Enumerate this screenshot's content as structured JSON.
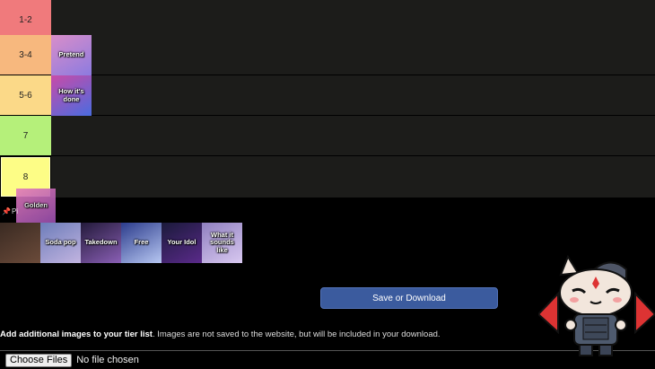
{
  "tiers": [
    {
      "label": "1-2",
      "color": "#f07a7c"
    },
    {
      "label": "3-4",
      "color": "#f7b87e"
    },
    {
      "label": "5-6",
      "color": "#fbd988"
    },
    {
      "label": "7",
      "color": "#b5f07a"
    },
    {
      "label": "8",
      "color": "#fdfd86"
    }
  ],
  "tier_items": {
    "t34": {
      "label": "Pretend",
      "colors": [
        "#d98ec9",
        "#8c7be0"
      ]
    },
    "t56": {
      "label": "How it's done",
      "colors": [
        "#c84ba8",
        "#4a6ce0"
      ]
    }
  },
  "dragging_item": {
    "label": "Golden",
    "colors": [
      "#e27ab9",
      "#9a4fb0"
    ]
  },
  "pin_label": "Pi",
  "pool": [
    {
      "label": "",
      "colors": [
        "#3a2a22",
        "#6b4b3a"
      ]
    },
    {
      "label": "Soda pop",
      "colors": [
        "#6d7dba",
        "#c2b4e0"
      ]
    },
    {
      "label": "Takedown",
      "colors": [
        "#231a3a",
        "#8a5fb5"
      ]
    },
    {
      "label": "Free",
      "colors": [
        "#2c3c8c",
        "#b7c7f2"
      ]
    },
    {
      "label": "Your Idol",
      "colors": [
        "#1a1a3a",
        "#5a2a8a"
      ]
    },
    {
      "label": "What it sounds like",
      "colors": [
        "#9080c0",
        "#d8c8f0"
      ]
    }
  ],
  "save_label": "Save or Download",
  "add_images": {
    "bold": "Add additional images to your tier list",
    "rest": ". Images are not saved to the website, but will be included in your download."
  },
  "file_input": {
    "button": "Choose Files",
    "status": "No file chosen"
  }
}
